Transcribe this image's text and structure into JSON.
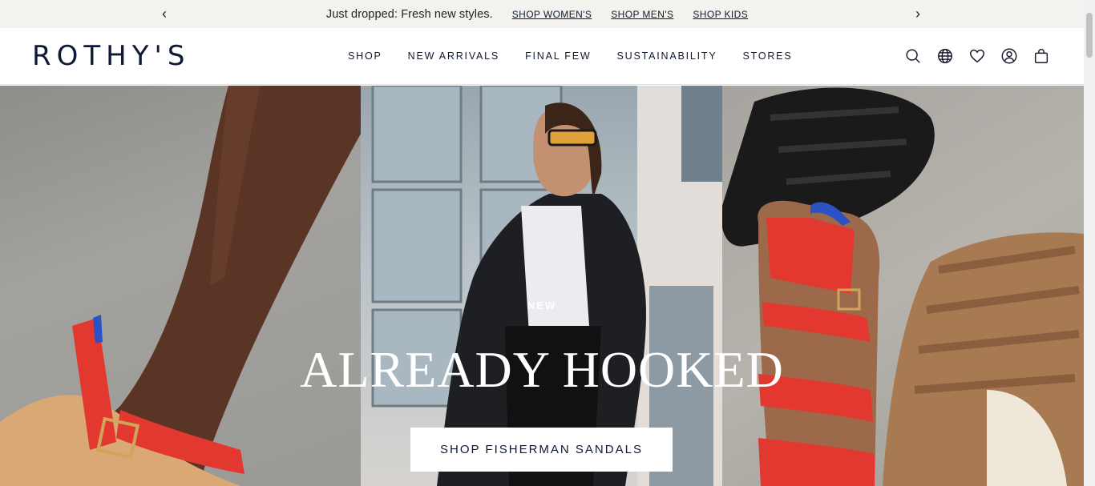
{
  "announcement": {
    "prev_arrow": "‹",
    "next_arrow": "›",
    "message": "Just dropped: Fresh new styles.",
    "links": [
      "SHOP WOMEN'S",
      "SHOP MEN'S",
      "SHOP KIDS"
    ]
  },
  "header": {
    "logo": "ROTHY'S",
    "nav": [
      "SHOP",
      "NEW ARRIVALS",
      "FINAL FEW",
      "SUSTAINABILITY",
      "STORES"
    ],
    "icons": [
      "search-icon",
      "globe-icon",
      "heart-icon",
      "account-icon",
      "bag-icon"
    ]
  },
  "hero": {
    "eyebrow": "NEW",
    "title": "ALREADY HOOKED",
    "cta": "SHOP FISHERMAN SANDALS"
  },
  "colors": {
    "navy": "#0e1a35",
    "announcement_bg": "#f3f2ef",
    "sandal_red": "#e2382f",
    "sandal_tan": "#a87a52"
  }
}
